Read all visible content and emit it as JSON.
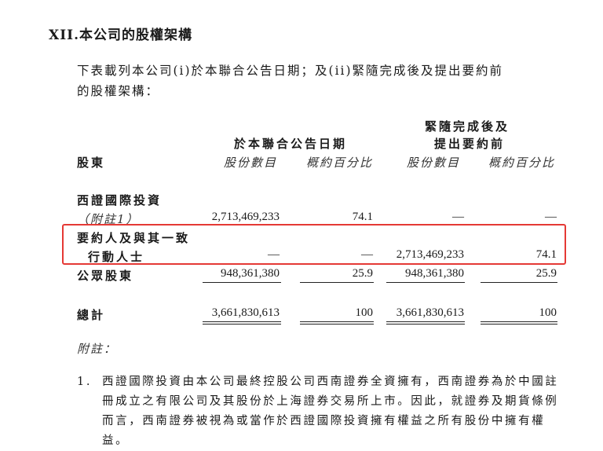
{
  "section_title": "XII.本公司的股權架構",
  "intro_lines": [
    "下表載列本公司(i)於本聯合公告日期；及(ii)緊隨完成後及提出要約前",
    "的股權架構："
  ],
  "table": {
    "group1_header": "於本聯合公告日期",
    "group2_header_line1": "緊隨完成後及",
    "group2_header_line2": "提出要約前",
    "shareholder_col": "股東",
    "shares_col": "股份數目",
    "pct_col": "概約百分比",
    "rows": [
      {
        "name_line1": "西證國際投資",
        "name_line2": "（附註1）",
        "shares1": "2,713,469,233",
        "pct1": "74.1",
        "shares2": "—",
        "pct2": "—"
      },
      {
        "name_line1": "要約人及與其一致",
        "name_line2": "行動人士",
        "shares1": "—",
        "pct1": "—",
        "shares2": "2,713,469,233",
        "pct2": "74.1"
      },
      {
        "name_line1": "公眾股東",
        "shares1": "948,361,380",
        "pct1": "25.9",
        "shares2": "948,361,380",
        "pct2": "25.9"
      }
    ],
    "total": {
      "name": "總計",
      "shares1": "3,661,830,613",
      "pct1": "100",
      "shares2": "3,661,830,613",
      "pct2": "100"
    }
  },
  "notes_header": "附註：",
  "notes": [
    {
      "number": "1.",
      "text": "西證國際投資由本公司最終控股公司西南證券全資擁有，西南證券為於中國註冊成立之有限公司及其股份於上海證券交易所上市。因此，就證券及期貨條例而言，西南證券被視為或當作於西證國際投資擁有權益之所有股份中擁有權益。"
    }
  ],
  "highlight_color": "#e53935"
}
